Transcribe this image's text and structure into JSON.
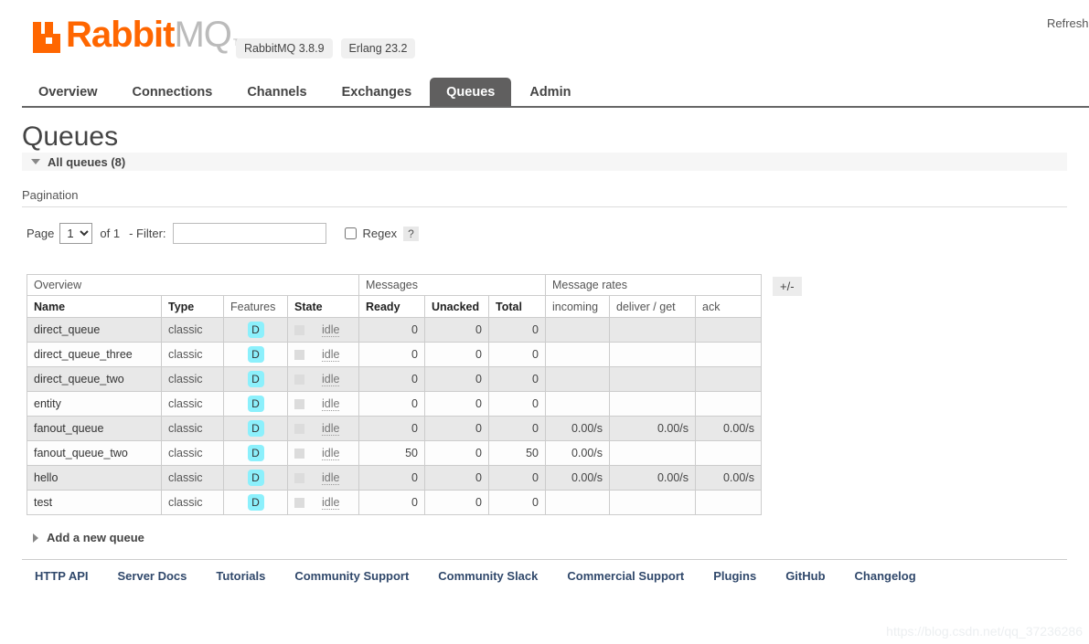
{
  "header": {
    "logo_rabbit": "Rabbit",
    "logo_mq": "MQ",
    "logo_tm": "TM",
    "version_badge": "RabbitMQ 3.8.9",
    "erlang_badge": "Erlang 23.2",
    "refresh_text": "Refreshed"
  },
  "nav": {
    "tabs": [
      {
        "label": "Overview",
        "active": false
      },
      {
        "label": "Connections",
        "active": false
      },
      {
        "label": "Channels",
        "active": false
      },
      {
        "label": "Exchanges",
        "active": false
      },
      {
        "label": "Queues",
        "active": true
      },
      {
        "label": "Admin",
        "active": false
      }
    ]
  },
  "page": {
    "title": "Queues",
    "section_label": "All queues (8)",
    "pagination_label": "Pagination"
  },
  "pagination": {
    "page_label": "Page",
    "page_value": "1",
    "page_options": [
      "1"
    ],
    "of_label": "of 1",
    "filter_label": "- Filter:",
    "filter_value": "",
    "filter_placeholder": "",
    "regex_label": "Regex",
    "regex_checked": false,
    "help_label": "?"
  },
  "table": {
    "group_headers": [
      {
        "label": "Overview",
        "span": 4
      },
      {
        "label": "Messages",
        "span": 3
      },
      {
        "label": "Message rates",
        "span": 3
      }
    ],
    "columns": [
      {
        "label": "Name",
        "style": "bold",
        "align": "left"
      },
      {
        "label": "Type",
        "style": "bold",
        "align": "left"
      },
      {
        "label": "Features",
        "style": "light",
        "align": "left"
      },
      {
        "label": "State",
        "style": "bold",
        "align": "left"
      },
      {
        "label": "Ready",
        "style": "bold",
        "align": "left"
      },
      {
        "label": "Unacked",
        "style": "bold",
        "align": "left"
      },
      {
        "label": "Total",
        "style": "bold",
        "align": "left"
      },
      {
        "label": "incoming",
        "style": "light",
        "align": "left"
      },
      {
        "label": "deliver / get",
        "style": "light",
        "align": "left"
      },
      {
        "label": "ack",
        "style": "light",
        "align": "left"
      }
    ],
    "toggle_columns_label": "+/-",
    "feature_badge": "D",
    "rows": [
      {
        "name": "direct_queue",
        "type": "classic",
        "features": "D",
        "state": "idle",
        "ready": "0",
        "unacked": "0",
        "total": "0",
        "incoming": "",
        "deliver_get": "",
        "ack": ""
      },
      {
        "name": "direct_queue_three",
        "type": "classic",
        "features": "D",
        "state": "idle",
        "ready": "0",
        "unacked": "0",
        "total": "0",
        "incoming": "",
        "deliver_get": "",
        "ack": ""
      },
      {
        "name": "direct_queue_two",
        "type": "classic",
        "features": "D",
        "state": "idle",
        "ready": "0",
        "unacked": "0",
        "total": "0",
        "incoming": "",
        "deliver_get": "",
        "ack": ""
      },
      {
        "name": "entity",
        "type": "classic",
        "features": "D",
        "state": "idle",
        "ready": "0",
        "unacked": "0",
        "total": "0",
        "incoming": "",
        "deliver_get": "",
        "ack": ""
      },
      {
        "name": "fanout_queue",
        "type": "classic",
        "features": "D",
        "state": "idle",
        "ready": "0",
        "unacked": "0",
        "total": "0",
        "incoming": "0.00/s",
        "deliver_get": "0.00/s",
        "ack": "0.00/s"
      },
      {
        "name": "fanout_queue_two",
        "type": "classic",
        "features": "D",
        "state": "idle",
        "ready": "50",
        "unacked": "0",
        "total": "50",
        "incoming": "0.00/s",
        "deliver_get": "",
        "ack": ""
      },
      {
        "name": "hello",
        "type": "classic",
        "features": "D",
        "state": "idle",
        "ready": "0",
        "unacked": "0",
        "total": "0",
        "incoming": "0.00/s",
        "deliver_get": "0.00/s",
        "ack": "0.00/s"
      },
      {
        "name": "test",
        "type": "classic",
        "features": "D",
        "state": "idle",
        "ready": "0",
        "unacked": "0",
        "total": "0",
        "incoming": "",
        "deliver_get": "",
        "ack": ""
      }
    ]
  },
  "add_queue": {
    "label": "Add a new queue"
  },
  "footer": {
    "links": [
      "HTTP API",
      "Server Docs",
      "Tutorials",
      "Community Support",
      "Community Slack",
      "Commercial Support",
      "Plugins",
      "GitHub",
      "Changelog"
    ]
  },
  "watermark": {
    "text": "https://blog.csdn.net/qq_37236286"
  },
  "colors": {
    "brand_orange": "#ff6600",
    "active_tab_bg": "#605f5f",
    "feature_badge_bg": "#8cf0fc",
    "footer_link": "#30486b"
  }
}
